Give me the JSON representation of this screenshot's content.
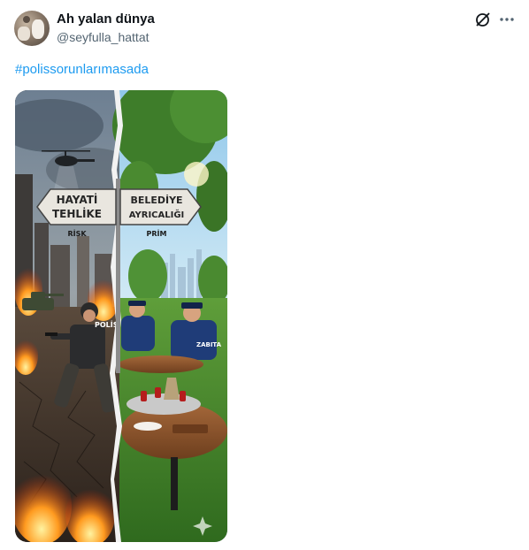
{
  "author": {
    "display_name": "Ah yalan dünya",
    "handle": "@seyfulla_hattat"
  },
  "header_icons": {
    "grok": "grok-icon",
    "more": "more-options-icon"
  },
  "tweet": {
    "hashtag": "#polissorunlarımasada"
  },
  "media": {
    "sign_left_line1": "HAYATİ",
    "sign_left_line2": "TEHLİKE",
    "sign_left_sub": "RİSK",
    "sign_right_line1": "BELEDİYE",
    "sign_right_line2": "AYRICALIĞI",
    "sign_right_sub": "PRİM",
    "vest_label": "POLİS",
    "zabita_label": "ZABITA"
  },
  "colors": {
    "hashtag": "#1d9bf0",
    "secondary_text": "#536471"
  }
}
